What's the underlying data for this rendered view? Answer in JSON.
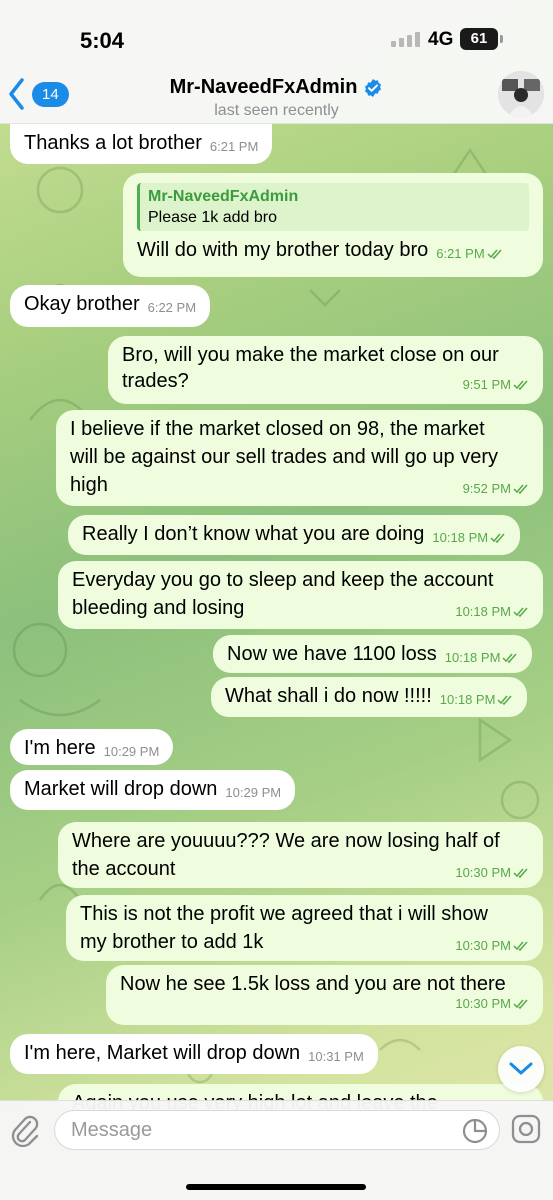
{
  "status_bar": {
    "time": "5:04",
    "network": "4G",
    "battery": "61"
  },
  "header": {
    "back_count": "14",
    "title": "Mr-NaveedFxAdmin",
    "subtitle": "last seen recently",
    "verified_icon": "verified-badge-icon",
    "colors": {
      "accent": "#1b8be8",
      "outgoing_bubble": "#effdde",
      "check": "#58a84b"
    }
  },
  "messages": [
    {
      "dir": "in",
      "text": "Thanks a lot brother",
      "time": "6:21 PM"
    },
    {
      "dir": "out",
      "reply_name": "Mr-NaveedFxAdmin",
      "reply_text": "Please 1k add bro",
      "text": "Will do with my brother today bro",
      "time": "6:21 PM"
    },
    {
      "dir": "in",
      "text": "Okay brother",
      "time": "6:22 PM"
    },
    {
      "dir": "out",
      "lines": [
        "Bro, will you make the market close on our",
        "trades?"
      ],
      "time": "9:51 PM"
    },
    {
      "dir": "out",
      "lines": [
        "I believe if the market closed on 98, the market",
        "will be against our sell trades and will go up very",
        "high"
      ],
      "time": "9:52 PM"
    },
    {
      "dir": "out",
      "text": "Really I don’t know what you are doing",
      "time": "10:18 PM"
    },
    {
      "dir": "out",
      "lines": [
        "Everyday you go to sleep and keep the account",
        "bleeding and losing"
      ],
      "time": "10:18 PM"
    },
    {
      "dir": "out",
      "text": "Now we have 1100 loss",
      "time": "10:18 PM"
    },
    {
      "dir": "out",
      "text": "What shall i do now !!!!!",
      "time": "10:18 PM"
    },
    {
      "dir": "in",
      "text": "I'm here",
      "time": "10:29 PM"
    },
    {
      "dir": "in",
      "text": "Market will drop down",
      "time": "10:29 PM"
    },
    {
      "dir": "out",
      "lines": [
        "Where are youuuu??? We are now losing half of",
        "the account"
      ],
      "time": "10:30 PM"
    },
    {
      "dir": "out",
      "lines": [
        "This is not the profit we agreed that i will show",
        "my brother to add 1k"
      ],
      "time": "10:30 PM"
    },
    {
      "dir": "out",
      "text": "Now he see 1.5k loss and you are not there",
      "time": "10:30 PM"
    },
    {
      "dir": "in",
      "text": "I'm here, Market will drop down",
      "time": "10:31 PM"
    },
    {
      "dir": "out",
      "text": "Again you use very high lot and leave the",
      "time": ""
    }
  ],
  "input": {
    "placeholder": "Message"
  }
}
